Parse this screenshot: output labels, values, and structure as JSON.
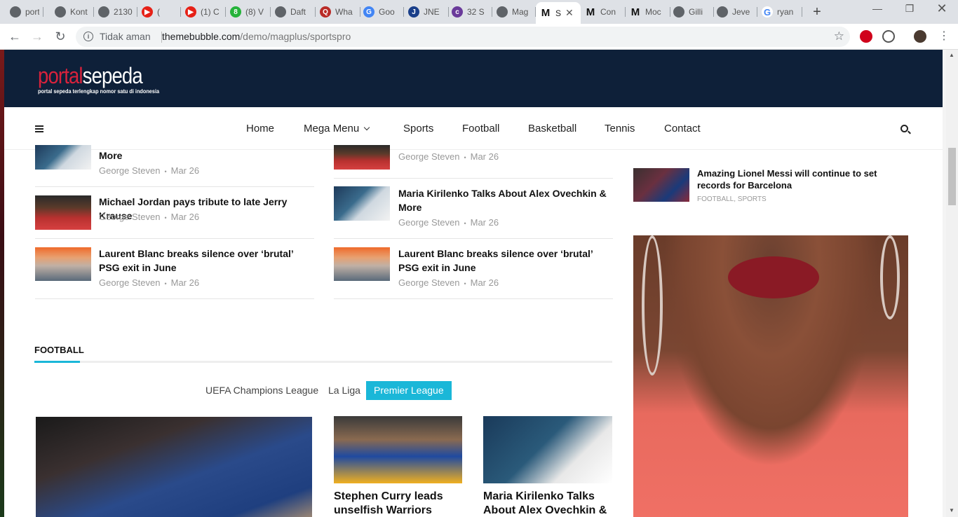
{
  "browser": {
    "tabs": [
      {
        "label": "port",
        "icon": "globe-icon"
      },
      {
        "label": "Kont",
        "icon": "globe-icon"
      },
      {
        "label": "2130",
        "icon": "globe-icon"
      },
      {
        "label": "(",
        "icon": "youtube-icon"
      },
      {
        "label": "(1) C",
        "icon": "youtube-icon"
      },
      {
        "label": "(8) V",
        "icon": "whatsapp-icon"
      },
      {
        "label": "Daft",
        "icon": "globe-icon"
      },
      {
        "label": "Wha",
        "icon": "quora-icon"
      },
      {
        "label": "Goo",
        "icon": "translate-icon"
      },
      {
        "label": "JNE",
        "icon": "jne-icon"
      },
      {
        "label": "32 S",
        "icon": "coolor-icon"
      },
      {
        "label": "Mag",
        "icon": "globe-icon"
      },
      {
        "label": "S",
        "icon": "m-logo-icon"
      },
      {
        "label": "Con",
        "icon": "m-logo-icon"
      },
      {
        "label": "Moc",
        "icon": "m-logo-icon"
      },
      {
        "label": "Gilli",
        "icon": "globe-icon"
      },
      {
        "label": "Jeve",
        "icon": "globe-icon"
      },
      {
        "label": "ryan",
        "icon": "google-icon"
      }
    ],
    "security_label": "Tidak aman",
    "url_host": "themebubble.com",
    "url_path": "/demo/magplus/sportspro"
  },
  "site": {
    "logo_a": "portal",
    "logo_b": "sepeda",
    "tagline": "portal sepeda terlengkap nomor satu di indonesia",
    "nav": [
      "Home",
      "Mega Menu",
      "Sports",
      "Football",
      "Basketball",
      "Tennis",
      "Contact"
    ]
  },
  "col1": [
    {
      "title": "More",
      "author": "George Steven",
      "date": "Mar 26"
    },
    {
      "title": "Michael Jordan pays tribute to late Jerry Krause",
      "author": "George Steven",
      "date": "Mar 26"
    },
    {
      "title": "Laurent Blanc breaks silence over ‘brutal’ PSG exit in June",
      "author": "George Steven",
      "date": "Mar 26"
    }
  ],
  "col2": [
    {
      "title": "",
      "author": "George Steven",
      "date": "Mar 26"
    },
    {
      "title": "Maria Kirilenko Talks About Alex Ovechkin & More",
      "author": "George Steven",
      "date": "Mar 26"
    },
    {
      "title": "Laurent Blanc breaks silence over ‘brutal’ PSG exit in June",
      "author": "George Steven",
      "date": "Mar 26"
    }
  ],
  "sidebar": {
    "title": "Amazing Lionel Messi will continue to set records for Barcelona",
    "categories": "FOOTBALL, SPORTS"
  },
  "football": {
    "heading": "FOOTBALL",
    "tabs": [
      "UEFA Champions League",
      "La Liga",
      "Premier League"
    ],
    "cards": [
      {
        "title": "Stephen Curry leads unselfish Warriors"
      },
      {
        "title": "Maria Kirilenko Talks About Alex Ovechkin &"
      }
    ]
  },
  "meta_separator": "•"
}
